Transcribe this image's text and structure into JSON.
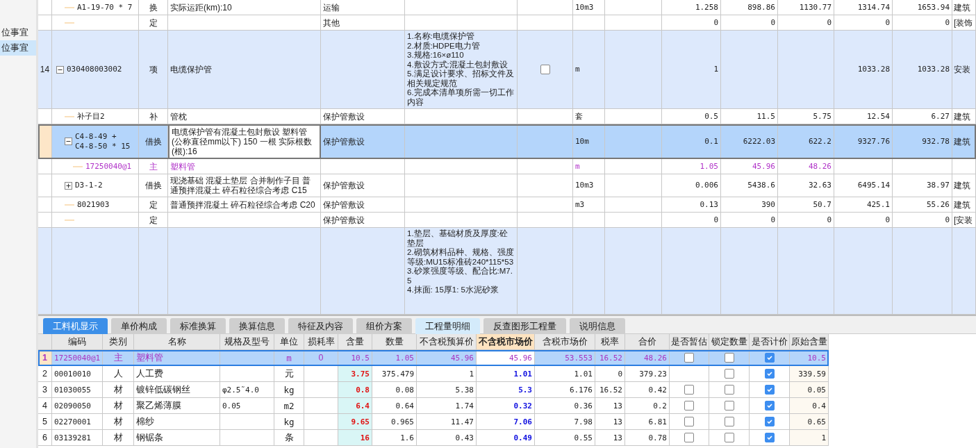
{
  "sidebar": {
    "items": [
      {
        "label": "位事宜",
        "selected": false
      },
      {
        "label": "位事宜",
        "selected": true
      }
    ]
  },
  "bill_table": {
    "rows": [
      {
        "children": [
          {
            "kind": "quota",
            "code": "A1-19-70 * 7",
            "type": "换",
            "name": " 实际运距(km):10",
            "project": "运输",
            "unit": "10m3",
            "column_10": "1.258",
            "column_11": "898.86",
            "column_12": "1130.77",
            "column_13": "1314.74",
            "column_14": "1653.94",
            "column_15": "建筑"
          },
          {
            "kind": "quota",
            "type": "定",
            "project": "其他",
            "column_10": "0",
            "column_11": "0",
            "column_12": "0",
            "column_13": "0",
            "column_14": "0",
            "column_15": "[装饰"
          }
        ]
      },
      {
        "kind": "bill",
        "no": "14",
        "code": "030408003002",
        "expanded": true,
        "type": "项",
        "name": "电缆保护管",
        "description": "1.名称:电缆保护管\n2.材质:HDPE电力管\n3.规格:16×ø110\n4.敷设方式:混凝土包封敷设\n5.满足设计要求、招标文件及相关规定规范\n6.完成本清单项所需一切工作内容",
        "checked": false,
        "unit": "m",
        "column_10": "1",
        "column_13": "1033.28",
        "column_14": "1033.28",
        "column_15": "安装",
        "selected": false,
        "children": [
          {
            "kind": "quota",
            "code": "补子目2",
            "type": "补",
            "name": "管枕",
            "project": "保护管敷设",
            "unit": "套",
            "column_10": "0.5",
            "column_11": "11.5",
            "column_12": "5.75",
            "column_13": "12.54",
            "column_14": "6.27",
            "column_15": "建筑",
            "selected": false
          },
          {
            "kind": "quota",
            "code": "C4-8-49 +\nC4-8-50 * 15",
            "expanded": true,
            "type": "借换",
            "name": "电缆保护管有混凝土包封敷设 塑料管(公称直径mm以下) 150 一根  实际根数(根):16",
            "project": "保护管敷设",
            "unit": "10m",
            "column_10": "0.1",
            "column_11": "6222.03",
            "column_12": "622.2",
            "column_13": "9327.76",
            "column_14": "932.78",
            "column_15": "建筑",
            "selected": true,
            "children": [
              {
                "kind": "material",
                "code": "17250040@1",
                "type": "主",
                "name": "塑料管",
                "unit": "m",
                "column_10": "1.05",
                "column_11": "45.96",
                "column_12": "48.26",
                "selected": false
              }
            ]
          },
          {
            "kind": "quota",
            "code": "D3-1-2",
            "expanded": false,
            "type": "借换",
            "name": "现浇基础 混凝土垫层  合并制作子目 普通预拌混凝土 碎石粒径综合考虑 C15",
            "project": "保护管敷设",
            "unit": "10m3",
            "column_10": "0.006",
            "column_11": "5438.6",
            "column_12": "32.63",
            "column_13": "6495.14",
            "column_14": "38.97",
            "column_15": "建筑",
            "selected": false
          },
          {
            "kind": "quota",
            "code": "8021903",
            "type": "定",
            "name": "普通预拌混凝土 碎石粒径综合考虑 C20",
            "project": "保护管敷设",
            "unit": "m3",
            "column_10": "0.13",
            "column_11": "390",
            "column_12": "50.7",
            "column_13": "425.1",
            "column_14": "55.26",
            "column_15": "建筑",
            "selected": false
          },
          {
            "kind": "quota",
            "type": "定",
            "project": "保护管敷设",
            "column_10": "0",
            "column_11": "0",
            "column_12": "0",
            "column_13": "0",
            "column_14": "0",
            "column_15": "[安装",
            "selected": false
          }
        ]
      },
      {
        "kind": "bill",
        "description": "1.垫层、基础材质及厚度:砼垫层\n2.砌筑材料品种、规格、强度等级:MU15标准砖240*115*53\n3.砂浆强度等级、配合比:M7.5\n4.抹面: 15厚1: 5水泥砂浆",
        "selected": false
      }
    ]
  },
  "detail_tabs": [
    {
      "label": "工料机显示",
      "selected": true,
      "highlighted": false
    },
    {
      "label": "单价构成",
      "selected": false,
      "highlighted": false
    },
    {
      "label": "标准换算",
      "selected": false,
      "highlighted": false
    },
    {
      "label": "换算信息",
      "selected": false,
      "highlighted": false
    },
    {
      "label": "特征及内容",
      "selected": false,
      "highlighted": false
    },
    {
      "label": "组价方案",
      "selected": false,
      "highlighted": false
    },
    {
      "label": "工程量明细",
      "selected": false,
      "highlighted": true
    },
    {
      "label": "反查图形工程量",
      "selected": false,
      "highlighted": false
    },
    {
      "label": "说明信息",
      "selected": false,
      "highlighted": false
    }
  ],
  "resource_table": {
    "columns": [
      {
        "label": "编码",
        "highlighted": false
      },
      {
        "label": "类别",
        "highlighted": false
      },
      {
        "label": "名称",
        "highlighted": false
      },
      {
        "label": "规格及型号",
        "highlighted": false
      },
      {
        "label": "单位",
        "highlighted": false
      },
      {
        "label": "损耗率",
        "highlighted": false
      },
      {
        "label": "含量",
        "highlighted": false
      },
      {
        "label": "数量",
        "highlighted": false
      },
      {
        "label": "不含税预算价",
        "highlighted": false
      },
      {
        "label": "不含税市场价",
        "highlighted": true
      },
      {
        "label": "含税市场价",
        "highlighted": false
      },
      {
        "label": "税率",
        "highlighted": false
      },
      {
        "label": "合价",
        "highlighted": false
      },
      {
        "label": "是否暂估",
        "highlighted": false
      },
      {
        "label": "锁定数量",
        "highlighted": false
      },
      {
        "label": "是否计价",
        "highlighted": false
      },
      {
        "label": "原始含量",
        "highlighted": false
      }
    ],
    "rows": [
      {
        "no": "1",
        "kind": "main",
        "selected": true,
        "modified": false,
        "code": "17250040@1",
        "category": "主",
        "name": "塑料管",
        "unit": "m",
        "loss_rate": "0",
        "content": "10.5",
        "quantity": "1.05",
        "budget_price": "45.96",
        "market_price": "45.96",
        "market_price_tax": "53.553",
        "tax_rate": "16.52",
        "total": "48.26",
        "estimated": false,
        "locked": false,
        "priced": true,
        "original_content": "10.5"
      },
      {
        "no": "2",
        "kind": "normal",
        "selected": false,
        "modified": true,
        "code": "00010010",
        "category": "人",
        "name": "人工费",
        "unit": "元",
        "content": "3.75",
        "quantity": "375.479",
        "budget_price": "1",
        "market_price": "1.01",
        "market_price_tax": "1.01",
        "tax_rate": "0",
        "total": "379.23",
        "locked": false,
        "priced": true,
        "original_content": "339.59"
      },
      {
        "no": "3",
        "kind": "normal",
        "selected": false,
        "modified": true,
        "code": "01030055",
        "category": "材",
        "name": "镀锌低碳钢丝",
        "spec": "φ2.5˜4.0",
        "unit": "kg",
        "content": "0.8",
        "quantity": "0.08",
        "budget_price": "5.38",
        "market_price": "5.3",
        "market_price_tax": "6.176",
        "tax_rate": "16.52",
        "total": "0.42",
        "estimated": false,
        "locked": false,
        "priced": true,
        "original_content": "0.05"
      },
      {
        "no": "4",
        "kind": "normal",
        "selected": false,
        "modified": true,
        "code": "02090050",
        "category": "材",
        "name": "聚乙烯薄膜",
        "spec": "0.05",
        "unit": "m2",
        "content": "6.4",
        "quantity": "0.64",
        "budget_price": "1.74",
        "market_price": "0.32",
        "market_price_tax": "0.36",
        "tax_rate": "13",
        "total": "0.2",
        "estimated": false,
        "locked": false,
        "priced": true,
        "original_content": "0.4"
      },
      {
        "no": "5",
        "kind": "normal",
        "selected": false,
        "modified": true,
        "code": "02270001",
        "category": "材",
        "name": "棉纱",
        "unit": "kg",
        "content": "9.65",
        "quantity": "0.965",
        "budget_price": "11.47",
        "market_price": "7.06",
        "market_price_tax": "7.98",
        "tax_rate": "13",
        "total": "6.81",
        "estimated": false,
        "locked": false,
        "priced": true,
        "original_content": "0.65"
      },
      {
        "no": "6",
        "kind": "normal",
        "selected": false,
        "modified": true,
        "code": "03139281",
        "category": "材",
        "name": "钢锯条",
        "unit": "条",
        "content": "16",
        "quantity": "1.6",
        "budget_price": "0.43",
        "market_price": "0.49",
        "market_price_tax": "0.55",
        "tax_rate": "13",
        "total": "0.78",
        "estimated": false,
        "locked": false,
        "priced": true,
        "original_content": "1"
      }
    ]
  }
}
